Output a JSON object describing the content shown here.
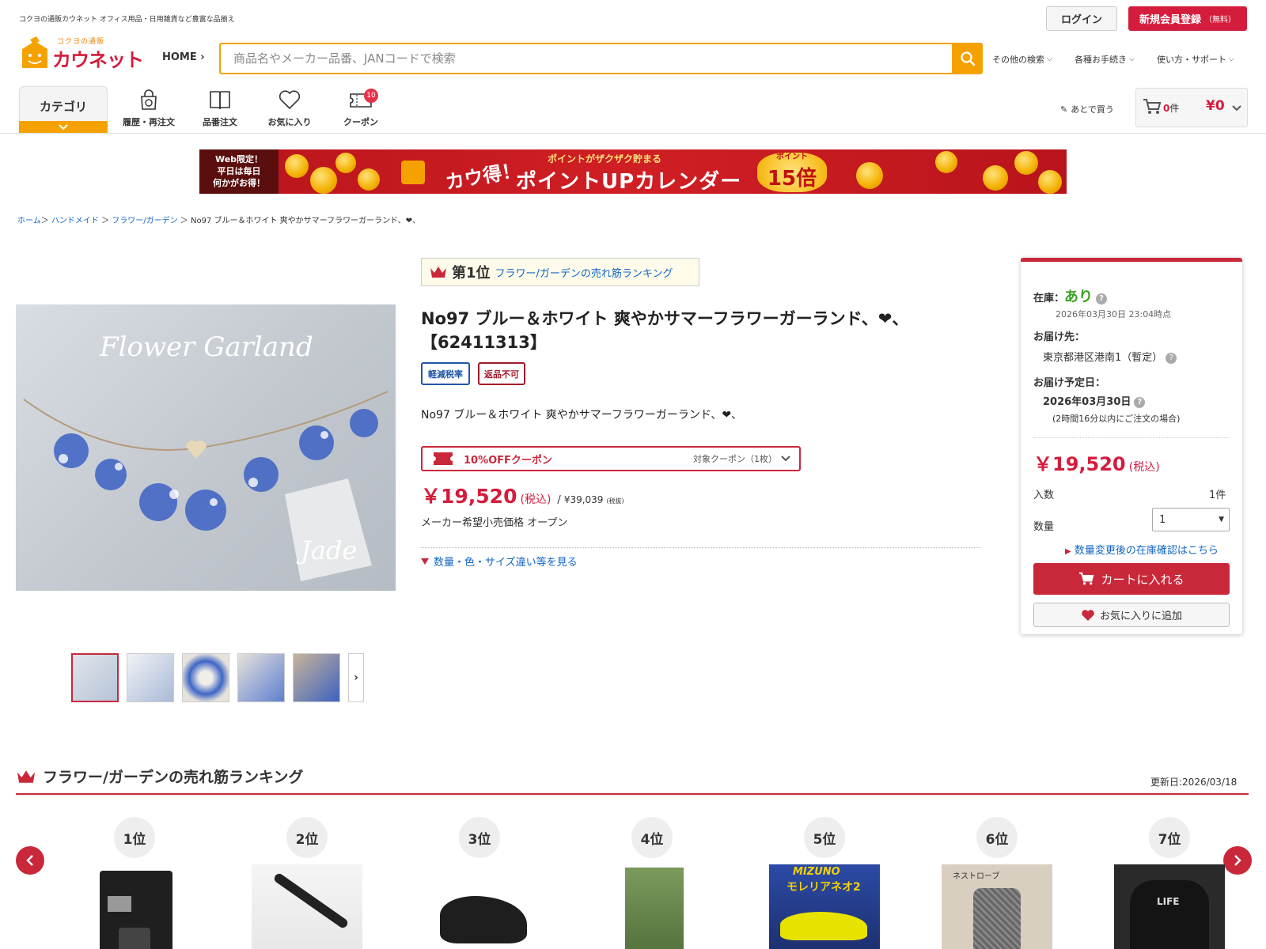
{
  "header": {
    "tagline": "コクヨの通販カウネット オフィス用品・日用雑貨など豊富な品揃え",
    "login": "ログイン",
    "register": "新規会員登録",
    "register_sub": "（無料）",
    "logo_small": "コクヨの通販",
    "logo_text": "カウネット",
    "home": "HOME",
    "search_placeholder": "商品名やメーカー品番、JANコードで検索",
    "nav": [
      "その他の検索",
      "各種お手続き",
      "使い方・サポート"
    ]
  },
  "subnav": {
    "category": "カテゴリ",
    "items": [
      {
        "label": "履歴・再注文",
        "icon": "history-icon"
      },
      {
        "label": "品番注文",
        "icon": "book-icon"
      },
      {
        "label": "お気に入り",
        "icon": "heart-icon"
      },
      {
        "label": "クーポン",
        "icon": "coupon-icon",
        "badge": "10"
      }
    ],
    "later": "あとで買う",
    "cart_count": "0",
    "cart_unit": "件",
    "cart_total": "¥0"
  },
  "banner": {
    "left_lines": [
      "Web限定！",
      "平日は毎日",
      "何かがお得！"
    ],
    "kau": "カウ得！",
    "sub": "ポイントがザクザク貯まる",
    "title": "ポイントUPカレンダー",
    "mult_label": "ポイント",
    "mult": "15倍"
  },
  "breadcrumb": {
    "items": [
      "ホーム",
      "ハンドメイド",
      "フラワー/ガーデン"
    ],
    "current": "No97 ブルー＆ホワイト 爽やかサマーフラワーガーランド、❤︎、"
  },
  "product": {
    "image_text": "Flower Garland",
    "image_sign": "Jade",
    "rank": "第1位",
    "rank_link": "フラワー/ガーデンの売れ筋ランキング",
    "title": "No97 ブルー＆ホワイト 爽やかサマーフラワーガーランド、❤︎、【62411313】",
    "tags": [
      "軽減税率",
      "返品不可"
    ],
    "description": "No97 ブルー＆ホワイト 爽やかサマーフラワーガーランド、❤︎、",
    "coupon_name": "10%OFFクーポン",
    "coupon_target": "対象クーポン（1枚）",
    "price": "￥19,520",
    "price_taxin": "(税込)",
    "price_sep": "/",
    "price_ex": "¥39,039",
    "price_exnote": "(税抜)",
    "maker_price": "メーカー希望小売価格 オープン",
    "variants": "数量・色・サイズ違い等を見る"
  },
  "panel": {
    "stock_label": "在庫：",
    "stock_value": "あり",
    "stock_time": "2026年03月30日 23:04時点",
    "dest_label": "お届け先：",
    "dest_value": "東京都港区港南1（暫定）",
    "date_label": "お届け予定日：",
    "date_value": "2026年03月30日",
    "date_note": "(2時間16分以内にご注文の場合)",
    "price": "￥19,520",
    "price_taxin": "(税込)",
    "pack_label": "入数",
    "pack_value": "1件",
    "qty_label": "数量",
    "qty_value": "1",
    "stock_check": "数量変更後の在庫確認はこちら",
    "cart_btn": "カートに入れる",
    "fav_btn": "お気に入りに追加",
    "stock_color": "#3aa11f"
  },
  "ranking": {
    "title": "フラワー/ガーデンの売れ筋ランキング",
    "updated": "更新日:2026/03/18",
    "items": [
      {
        "pos": "1位"
      },
      {
        "pos": "2位"
      },
      {
        "pos": "3位"
      },
      {
        "pos": "4位"
      },
      {
        "pos": "5位",
        "img_text1": "MIZUNO",
        "img_text2": "モレリアネオ2"
      },
      {
        "pos": "6位",
        "img_text1": "ネストローブ"
      },
      {
        "pos": "7位",
        "img_text1": "LIFE"
      }
    ]
  },
  "colors": {
    "brand_red": "#d41d3d",
    "accent_orange": "#f5a200",
    "link_blue": "#1066c4"
  }
}
